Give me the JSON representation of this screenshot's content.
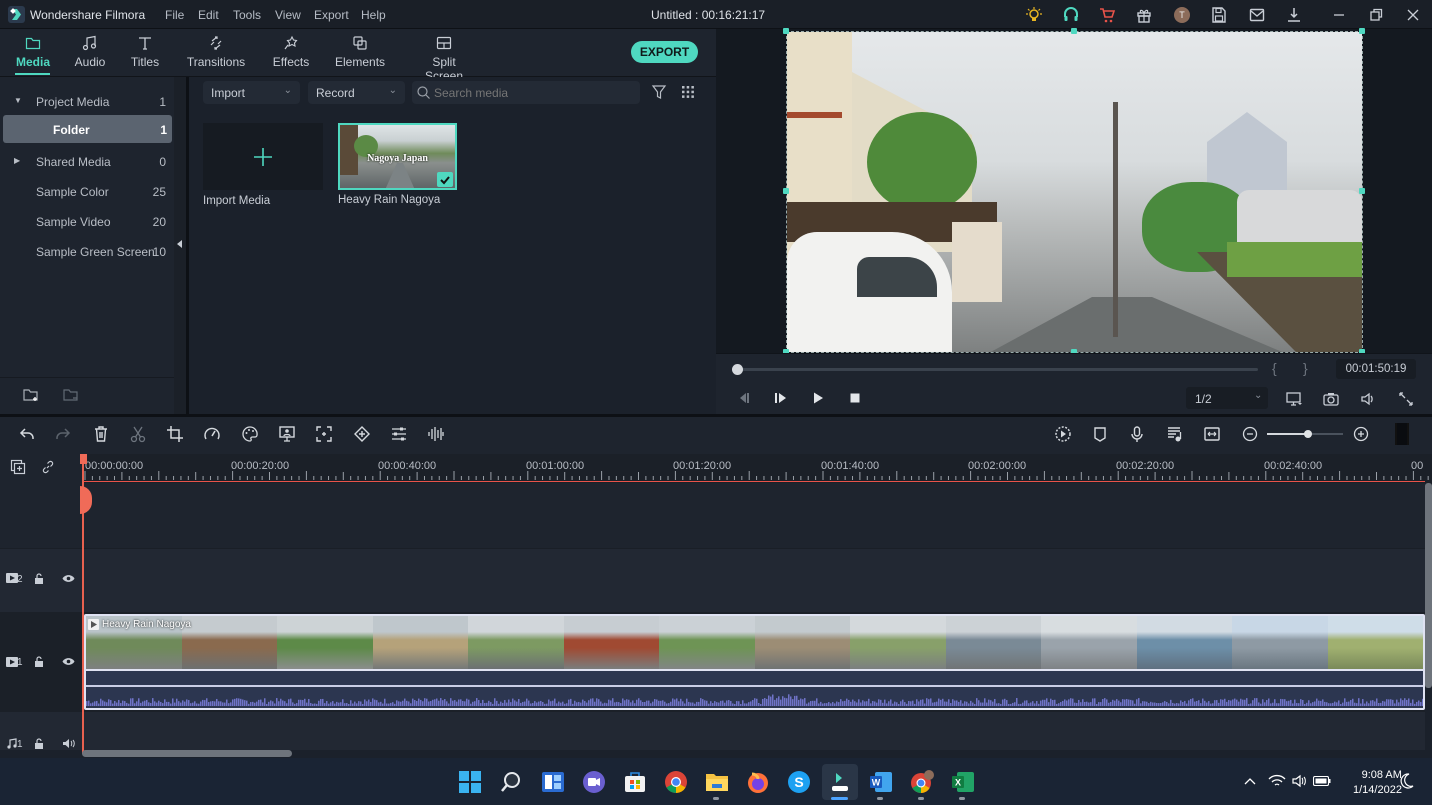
{
  "app": {
    "name": "Wondershare Filmora",
    "document_title": "Untitled : 00:16:21:17",
    "menu": [
      "File",
      "Edit",
      "Tools",
      "View",
      "Export",
      "Help"
    ],
    "title_icons": [
      "tip-bulb-icon",
      "support-headset-icon",
      "cart-icon",
      "gift-icon",
      "user-avatar",
      "save-icon",
      "mail-icon",
      "download-icon",
      "minimize-icon",
      "restore-icon",
      "close-icon"
    ],
    "avatar_initial": "T"
  },
  "tabs": [
    {
      "label": "Media",
      "icon": "folder-icon",
      "active": true
    },
    {
      "label": "Audio",
      "icon": "music-note-icon"
    },
    {
      "label": "Titles",
      "icon": "text-t-icon"
    },
    {
      "label": "Transitions",
      "icon": "transitions-icon"
    },
    {
      "label": "Effects",
      "icon": "effects-sparkle-icon"
    },
    {
      "label": "Elements",
      "icon": "elements-icon"
    },
    {
      "label": "Split Screen",
      "icon": "split-screen-icon"
    }
  ],
  "export_label": "EXPORT",
  "sidebar": {
    "items": [
      {
        "label": "Project Media",
        "count": "1",
        "arrow": "▼"
      },
      {
        "label": "Folder",
        "count": "1",
        "selected": true
      },
      {
        "label": "Shared Media",
        "count": "0",
        "arrow": "▶"
      },
      {
        "label": "Sample Color",
        "count": "25"
      },
      {
        "label": "Sample Video",
        "count": "20"
      },
      {
        "label": "Sample Green Screen",
        "count": "10"
      }
    ]
  },
  "media_toolbar": {
    "import_label": "Import",
    "record_label": "Record",
    "search_placeholder": "Search media"
  },
  "media_items": [
    {
      "label": "Import Media"
    },
    {
      "label": "Heavy Rain Nagoya",
      "overlay_text": "Nagoya Japan",
      "selected": true
    }
  ],
  "preview": {
    "timecode": "00:01:50:19",
    "progress": 0.0,
    "quality": "1/2",
    "bracket_in": "{",
    "bracket_out": "}"
  },
  "timeline": {
    "zoom_level": 0.54,
    "ruler_labels": [
      "00:00:00:00",
      "00:00:20:00",
      "00:00:40:00",
      "00:01:00:00",
      "00:01:20:00",
      "00:01:40:00",
      "00:02:00:00",
      "00:02:20:00",
      "00:02:40:00",
      "00"
    ],
    "tracks": [
      {
        "label": "2",
        "type": "video"
      },
      {
        "label": "1",
        "type": "video"
      },
      {
        "label": "1",
        "type": "audio"
      }
    ],
    "clip_title": "Heavy Rain Nagoya"
  },
  "taskbar": {
    "apps": [
      "windows-start",
      "search",
      "widgets",
      "teams-chat",
      "microsoft-store",
      "chrome",
      "file-explorer",
      "firefox",
      "skype",
      "filmora",
      "word",
      "chrome-profile",
      "excel"
    ],
    "time": "9:08 AM",
    "date": "1/14/2022"
  }
}
